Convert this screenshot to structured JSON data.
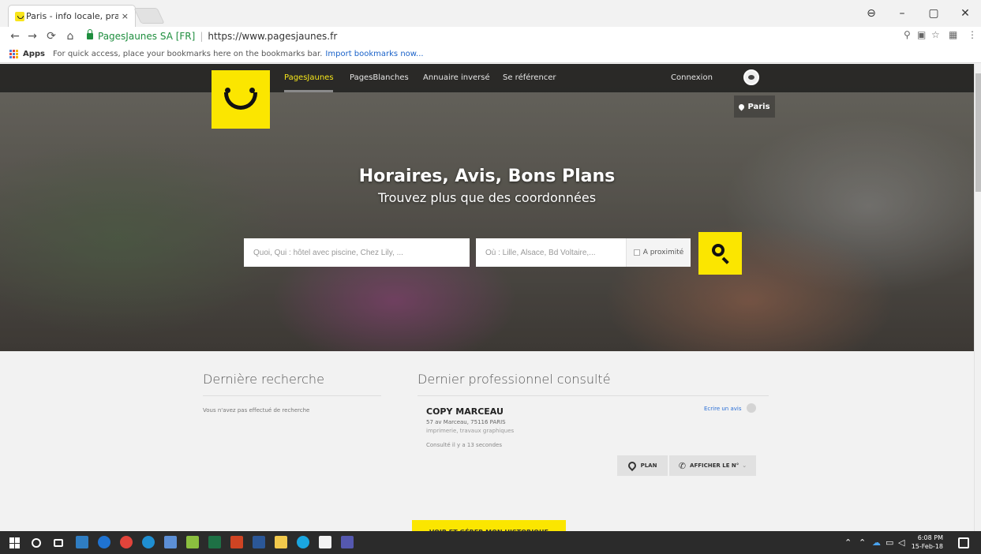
{
  "browser": {
    "tab_title": "Paris - info locale, pratiq",
    "tab_close": "×",
    "org": "PagesJaunes SA [FR]",
    "url": "https://www.pagesjaunes.fr",
    "bookmarks_apps": "Apps",
    "bookmarks_hint": "For quick access, place your bookmarks here on the bookmarks bar.",
    "bookmarks_import": "Import bookmarks now..."
  },
  "nav": {
    "items": [
      "PagesJaunes",
      "PagesBlanches",
      "Annuaire inversé",
      "Se référencer"
    ],
    "login": "Connexion",
    "city": "Paris"
  },
  "hero": {
    "title": "Horaires, Avis, Bons Plans",
    "subtitle": "Trouvez plus que des coordonnées",
    "what_placeholder": "Quoi, Qui : hôtel avec piscine, Chez Lily, ...",
    "where_placeholder": "Où : Lille, Alsace, Bd Voltaire,...",
    "proximity": "A proximité"
  },
  "recent": {
    "last_search_title": "Dernière recherche",
    "no_search": "Vous n'avez pas effectué de recherche",
    "last_pro_title": "Dernier professionnel consulté",
    "pro_name": "COPY MARCEAU",
    "pro_address": "57 av Marceau, 75116 PARIS",
    "pro_category": "imprimerie, travaux graphiques",
    "consulted": "Consulté il y a 13 secondes",
    "review_link": "Ecrire un avis",
    "plan_label": "PLAN",
    "phone_label": "AFFICHER LE N°",
    "history_button": "VOIR ET GÉRER MON HISTORIQUE"
  },
  "taskbar": {
    "time": "6:08 PM",
    "date": "15-Feb-18"
  },
  "colors": {
    "brand_yellow": "#fbe600",
    "link_blue": "#2a6fd6"
  }
}
